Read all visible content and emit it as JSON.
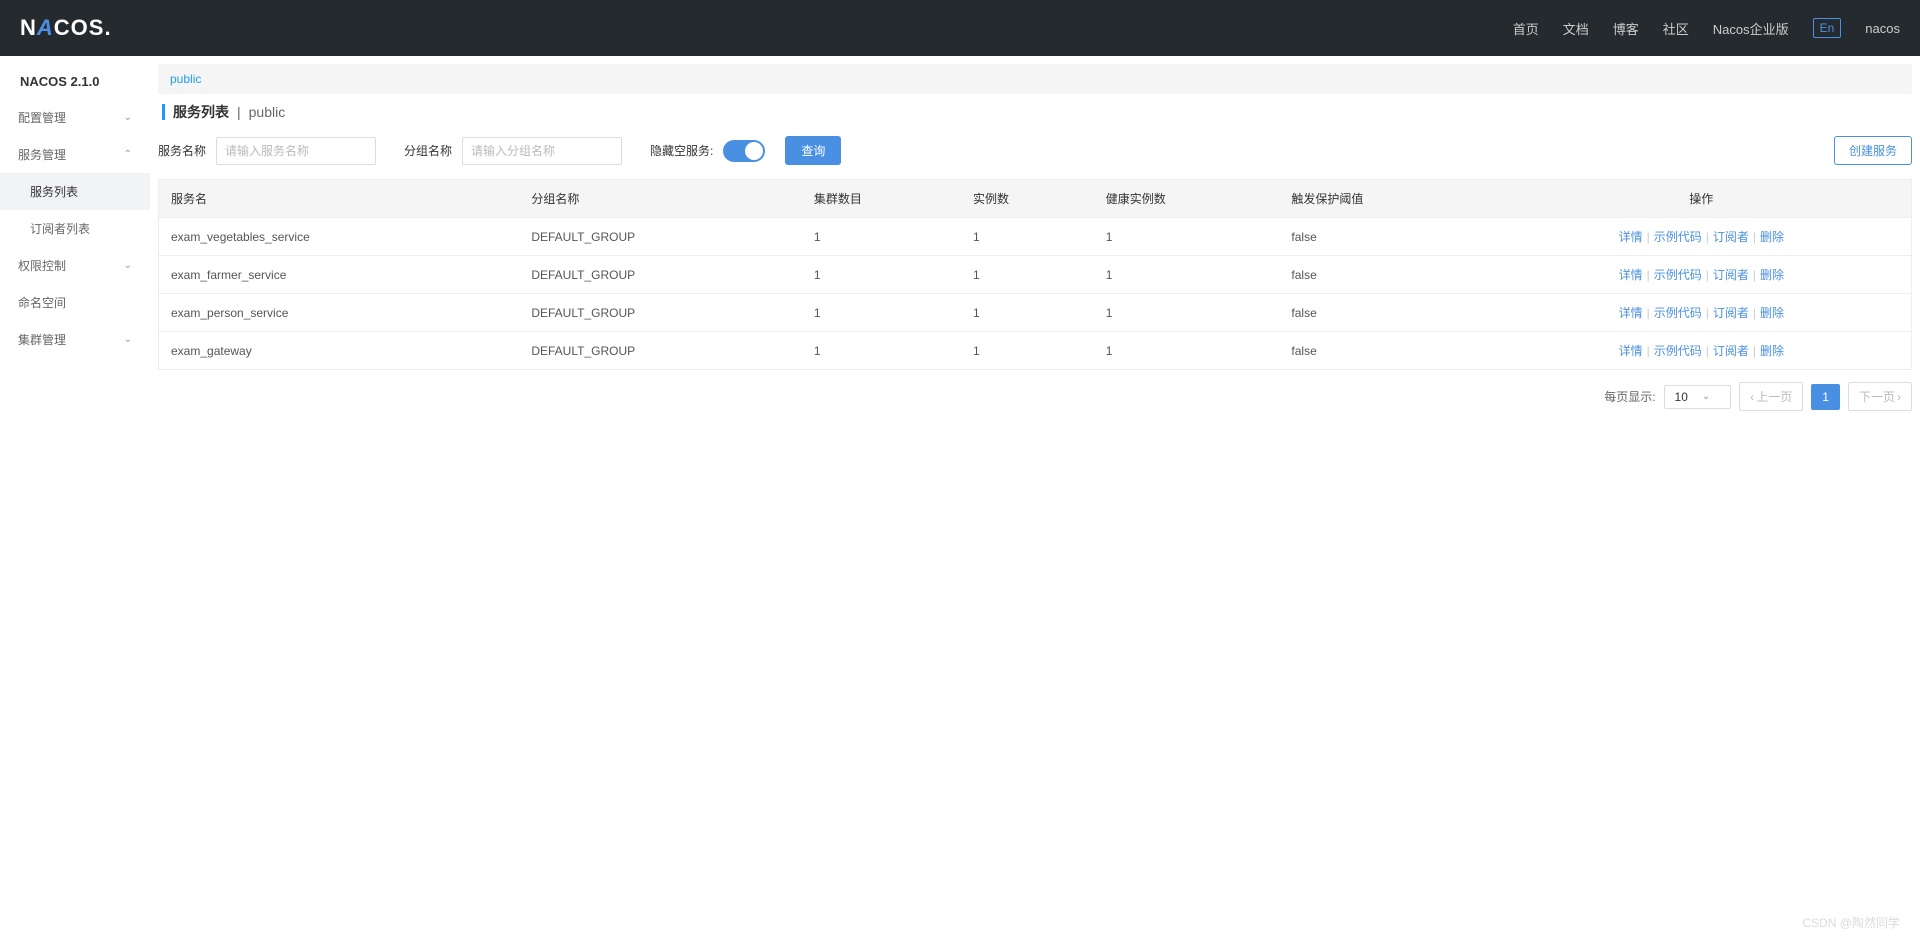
{
  "header": {
    "logo_pre": "N",
    "logo_a": "A",
    "logo_post": "COS.",
    "links": [
      "首页",
      "文档",
      "博客",
      "社区",
      "Nacos企业版"
    ],
    "lang": "En",
    "user": "nacos"
  },
  "sidebar": {
    "version": "NACOS 2.1.0",
    "items": [
      {
        "label": "配置管理",
        "expanded": false
      },
      {
        "label": "服务管理",
        "expanded": true,
        "children": [
          {
            "label": "服务列表",
            "active": true
          },
          {
            "label": "订阅者列表",
            "active": false
          }
        ]
      },
      {
        "label": "权限控制",
        "expanded": false
      },
      {
        "label": "命名空间",
        "expanded": false,
        "leaf": true
      },
      {
        "label": "集群管理",
        "expanded": false
      }
    ]
  },
  "tabs": {
    "namespace": "public"
  },
  "page": {
    "title": "服务列表",
    "subtitle": "public",
    "separator": " | "
  },
  "search": {
    "service_label": "服务名称",
    "service_placeholder": "请输入服务名称",
    "group_label": "分组名称",
    "group_placeholder": "请输入分组名称",
    "hide_empty_label": "隐藏空服务:",
    "query_btn": "查询",
    "create_btn": "创建服务"
  },
  "table": {
    "columns": [
      "服务名",
      "分组名称",
      "集群数目",
      "实例数",
      "健康实例数",
      "触发保护阈值",
      "操作"
    ],
    "rows": [
      {
        "name": "exam_vegetables_service",
        "group": "DEFAULT_GROUP",
        "clusters": "1",
        "instances": "1",
        "healthy": "1",
        "threshold": "false"
      },
      {
        "name": "exam_farmer_service",
        "group": "DEFAULT_GROUP",
        "clusters": "1",
        "instances": "1",
        "healthy": "1",
        "threshold": "false"
      },
      {
        "name": "exam_person_service",
        "group": "DEFAULT_GROUP",
        "clusters": "1",
        "instances": "1",
        "healthy": "1",
        "threshold": "false"
      },
      {
        "name": "exam_gateway",
        "group": "DEFAULT_GROUP",
        "clusters": "1",
        "instances": "1",
        "healthy": "1",
        "threshold": "false"
      }
    ],
    "actions": {
      "detail": "详情",
      "sample": "示例代码",
      "subscriber": "订阅者",
      "delete": "删除"
    }
  },
  "pagination": {
    "per_page_label": "每页显示:",
    "per_page_value": "10",
    "prev": "上一页",
    "next": "下一页",
    "current": "1"
  },
  "watermark": "CSDN @陶然同学"
}
